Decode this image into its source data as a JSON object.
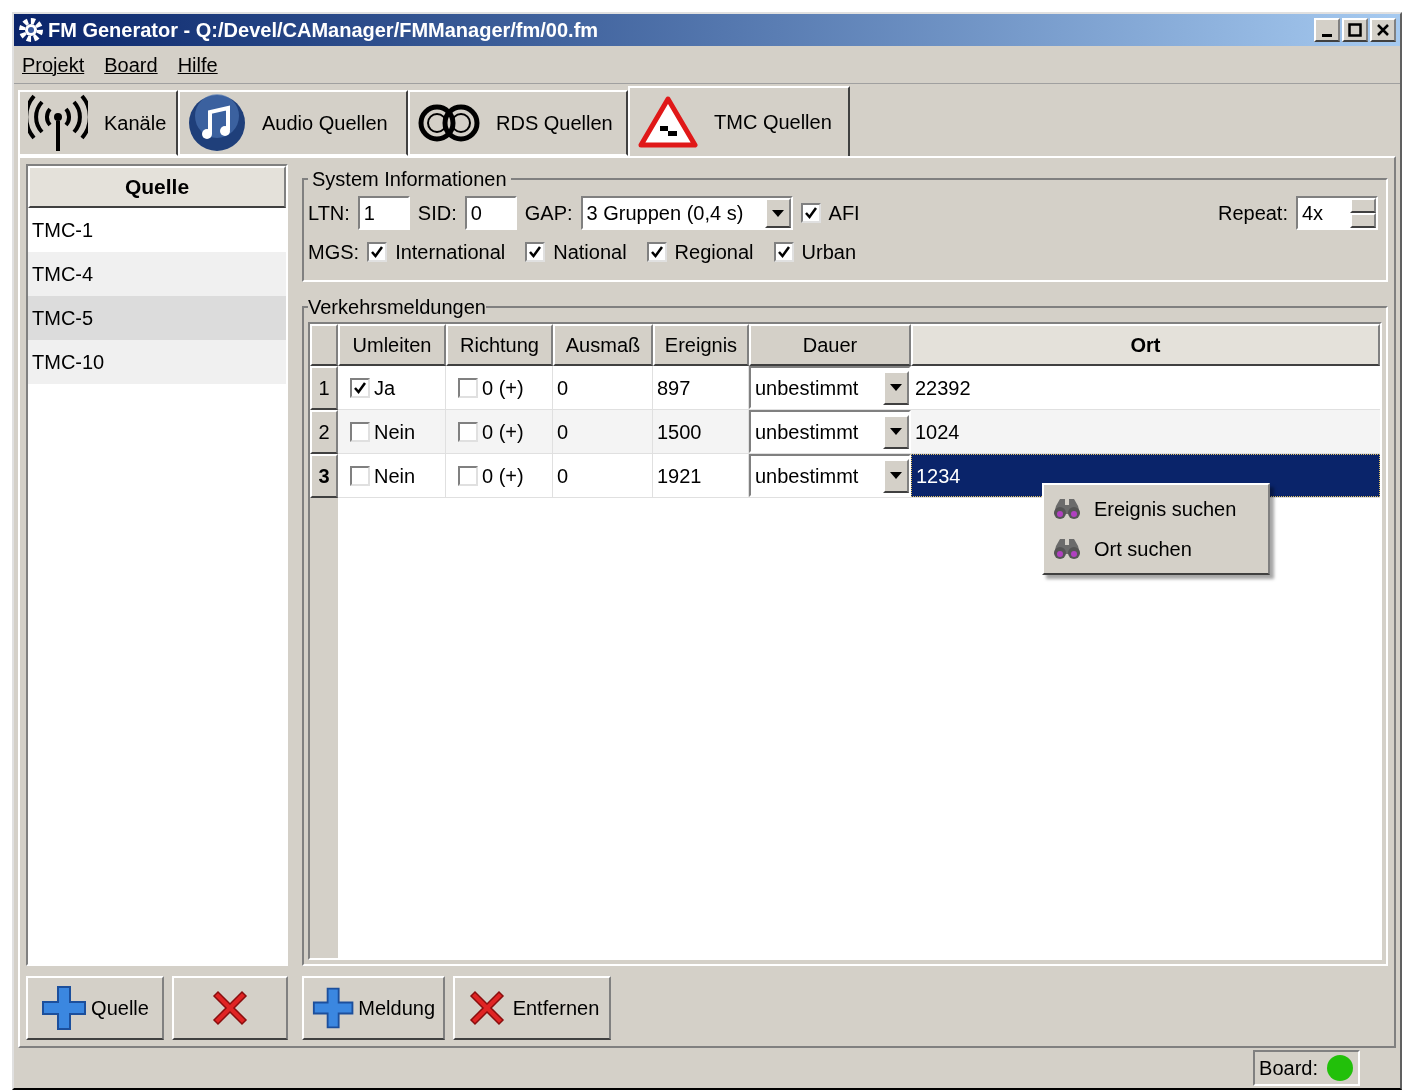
{
  "window": {
    "title": "FM Generator - Q:/Devel/CAManager/FMManager/fm/00.fm"
  },
  "menu": [
    "Projekt",
    "Board",
    "Hilfe"
  ],
  "tabs": [
    {
      "label": "Kanäle",
      "selected": false
    },
    {
      "label": "Audio Quellen",
      "selected": false
    },
    {
      "label": "RDS Quellen",
      "selected": false
    },
    {
      "label": "TMC Quellen",
      "selected": true
    }
  ],
  "sources": {
    "header": "Quelle",
    "items": [
      {
        "label": "TMC-1",
        "selected": false
      },
      {
        "label": "TMC-4",
        "selected": false
      },
      {
        "label": "TMC-5",
        "selected": true
      },
      {
        "label": "TMC-10",
        "selected": false
      }
    ]
  },
  "source_buttons": [
    {
      "kind": "add",
      "label": "Quelle"
    },
    {
      "kind": "remove"
    }
  ],
  "system_info": {
    "title": "System Informationen",
    "ltn": {
      "label": "LTN:",
      "value": "1"
    },
    "sid": {
      "label": "SID:",
      "value": "0"
    },
    "gap": {
      "label": "GAP:",
      "value": "3 Gruppen (0,4 s)"
    },
    "afi": {
      "label": "AFI",
      "checked": true
    },
    "repeat": {
      "label": "Repeat:",
      "value": "4x"
    },
    "mgs": {
      "label": "MGS:",
      "options": [
        {
          "label": "International",
          "checked": true
        },
        {
          "label": "National",
          "checked": true
        },
        {
          "label": "Regional",
          "checked": true
        },
        {
          "label": "Urban",
          "checked": true
        }
      ]
    }
  },
  "traffic": {
    "title": "Verkehrsmeldungen",
    "columns": [
      {
        "label": "Umleiten",
        "selected": false
      },
      {
        "label": "Richtung",
        "selected": false
      },
      {
        "label": "Ausmaß",
        "selected": false
      },
      {
        "label": "Ereignis",
        "selected": false
      },
      {
        "label": "Dauer",
        "selected": false
      },
      {
        "label": "Ort",
        "selected": true
      }
    ],
    "rows": [
      {
        "number": "1",
        "selected": false,
        "umleiten": {
          "checked": true,
          "text": "Ja"
        },
        "richtung": {
          "checked": false,
          "text": "0 (+)"
        },
        "ausmass": "0",
        "ereignis": "897",
        "dauer": "unbestimmt",
        "ort": "22392"
      },
      {
        "number": "2",
        "selected": false,
        "umleiten": {
          "checked": false,
          "text": "Nein"
        },
        "richtung": {
          "checked": false,
          "text": "0 (+)"
        },
        "ausmass": "0",
        "ereignis": "1500",
        "dauer": "unbestimmt",
        "ort": "1024"
      },
      {
        "number": "3",
        "selected": true,
        "umleiten": {
          "checked": false,
          "text": "Nein"
        },
        "richtung": {
          "checked": false,
          "text": "0 (+)"
        },
        "ausmass": "0",
        "ereignis": "1921",
        "dauer": "unbestimmt",
        "ort": "1234"
      }
    ]
  },
  "context_menu": [
    "Ereignis suchen",
    "Ort suchen"
  ],
  "message_buttons": [
    {
      "kind": "add",
      "label": "Meldung"
    },
    {
      "kind": "remove",
      "label": "Entfernen"
    }
  ],
  "status_bar": {
    "label": "Board:",
    "color": "#22c00a"
  }
}
